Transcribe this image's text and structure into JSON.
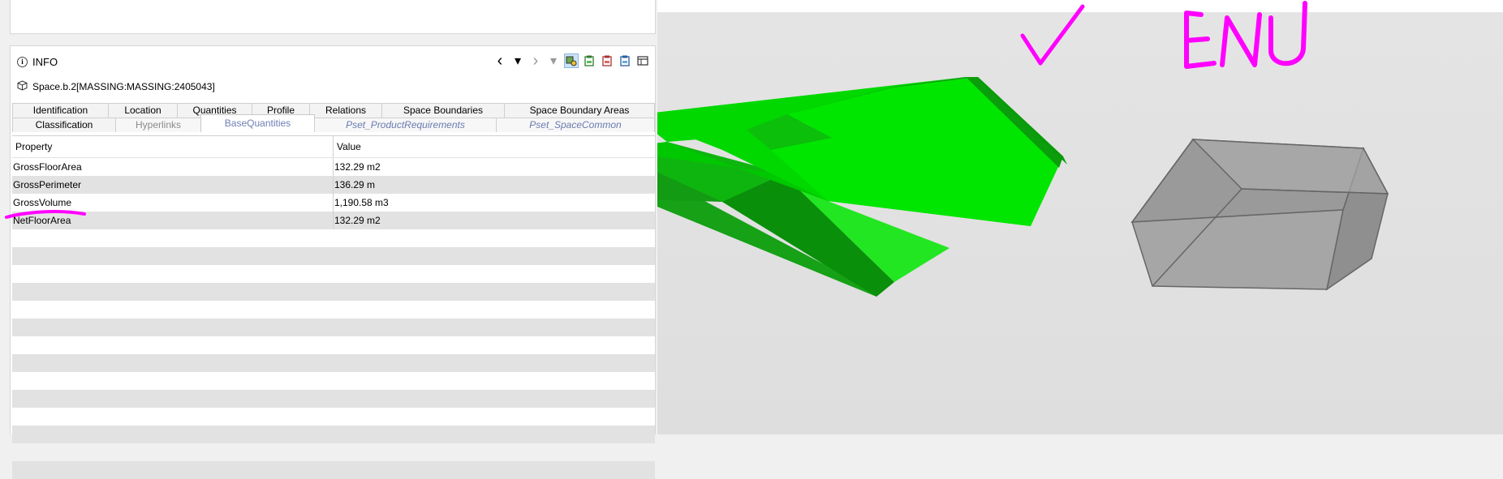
{
  "info": {
    "title": "INFO",
    "entity": "Space.b.2[MASSING:MASSING:2405043]"
  },
  "toolbar": {
    "back_icon": "‹",
    "dropdown_icon": "▾",
    "forward_icon": "›",
    "dropdown2_icon": "▾"
  },
  "tabs": {
    "row1": [
      "Identification",
      "Location",
      "Quantities",
      "Profile",
      "Relations",
      "Space Boundaries",
      "Space Boundary Areas"
    ],
    "row2": [
      "Classification",
      "Hyperlinks",
      "BaseQuantities",
      "Pset_ProductRequirements",
      "Pset_SpaceCommon"
    ]
  },
  "table": {
    "headers": [
      "Property",
      "Value"
    ],
    "rows": [
      [
        "GrossFloorArea",
        "132.29 m2"
      ],
      [
        "GrossPerimeter",
        "136.29 m"
      ],
      [
        "GrossVolume",
        "1,190.58 m3"
      ],
      [
        "NetFloorArea",
        "132.29 m2"
      ]
    ]
  },
  "colors": {
    "accent": "#ff00ff",
    "space_green": "#00e000",
    "box_gray": "#9a9a9a"
  }
}
